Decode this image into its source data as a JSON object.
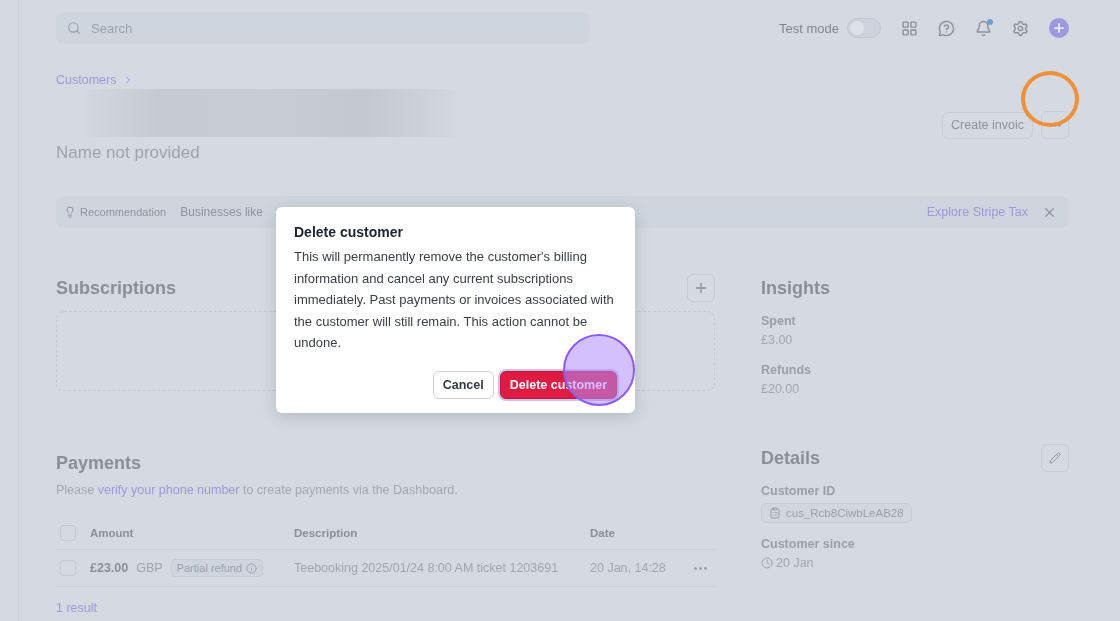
{
  "topbar": {
    "search": {
      "placeholder": "Search"
    },
    "test_mode": {
      "label": "Test mode",
      "on": false
    }
  },
  "header": {
    "breadcrumb": "Customers",
    "subtitle": "Name not provided",
    "buttons": [
      {
        "label": "Create invoic"
      }
    ]
  },
  "recommendation": {
    "tag": "Recommendation",
    "text": "Businesses like",
    "link": "Explore Stripe Tax"
  },
  "subscriptions": {
    "title": "Subscriptions"
  },
  "payments": {
    "title": "Payments",
    "note": {
      "before": "Please",
      "link": "verify your phone number",
      "after": "to create payments via the Dashboard."
    },
    "table": {
      "select_all_checked": false,
      "columns": [
        "Amount",
        "Description",
        "Date"
      ],
      "rows": [
        {
          "checked": false,
          "amount": "£23.00",
          "currency": "GBP",
          "badge": "Partial refund",
          "description": "Teebooking 2025/01/24 8:00 AM ticket 1203691",
          "date": "20 Jan, 14:28"
        }
      ]
    },
    "footer": "1 result"
  },
  "insights": {
    "title": "Insights",
    "items": [
      {
        "label": "Spent",
        "value": "£3.00"
      },
      {
        "label": "Refunds",
        "value": "£20.00"
      }
    ]
  },
  "details": {
    "title": "Details",
    "customer_id_label": "Customer ID",
    "customer_id": "cus_Rcb8CiwbLeAB28",
    "since_label": "Customer since",
    "since": "20 Jan"
  },
  "dialog": {
    "title": "Delete customer",
    "body": "This will permanently remove the customer's billing information and cancel any current subscriptions immediately. Past payments or invoices associated with the customer will still remain. This action cannot be undone.",
    "buttons": [
      {
        "label": "Cancel",
        "kind": "secondary"
      },
      {
        "label": "Delete customer",
        "kind": "danger"
      }
    ]
  }
}
